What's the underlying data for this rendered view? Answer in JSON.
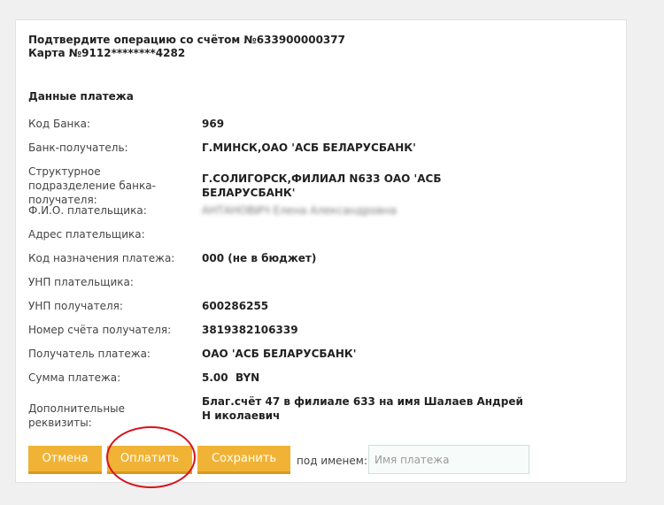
{
  "header": {
    "line1": "Подтвердите операцию со счётом №633900000377",
    "line2": "Карта №9112********4282"
  },
  "section_title": "Данные платежа",
  "rows": [
    {
      "label": "Код Банка:",
      "value": "969"
    },
    {
      "label": "Банк-получатель:",
      "value": "Г.МИНСК,ОАО 'АСБ БЕЛАРУСБАНК'"
    },
    {
      "label": "Структурное подразделение банка-получателя:",
      "value": "Г.СОЛИГОРСК,ФИЛИАЛ N633 ОАО 'АСБ БЕЛАРУСБАНК'"
    },
    {
      "label": "Ф.И.О. плательщика:",
      "value": "АНТАНОВИЧ Елена Александровна"
    },
    {
      "label": "Адрес плательщика:",
      "value": ""
    },
    {
      "label": "Код назначения платежа:",
      "value": "000 (не в бюджет)"
    },
    {
      "label": "УНП плательщика:",
      "value": ""
    },
    {
      "label": "УНП получателя:",
      "value": "600286255"
    },
    {
      "label": "Номер счёта получателя:",
      "value": "3819382106339"
    },
    {
      "label": "Получатель платежа:",
      "value": "ОАО 'АСБ БЕЛАРУСБАНК'"
    },
    {
      "label": "Сумма платежа:",
      "value": "5.00  BYN"
    },
    {
      "label": "Дополнительные реквизиты:",
      "value": "Благ.счёт 47 в филиале 633 на имя Шалаев Андрей Н иколаевич"
    }
  ],
  "actions": {
    "cancel_label": "Отмена",
    "pay_label": "Оплатить",
    "save_label": "Сохранить",
    "under_name_label": "под именем:",
    "payment_name_placeholder": "Имя платежа"
  },
  "colors": {
    "button_bg": "#f0b335",
    "highlight_ring": "#d8121e"
  }
}
